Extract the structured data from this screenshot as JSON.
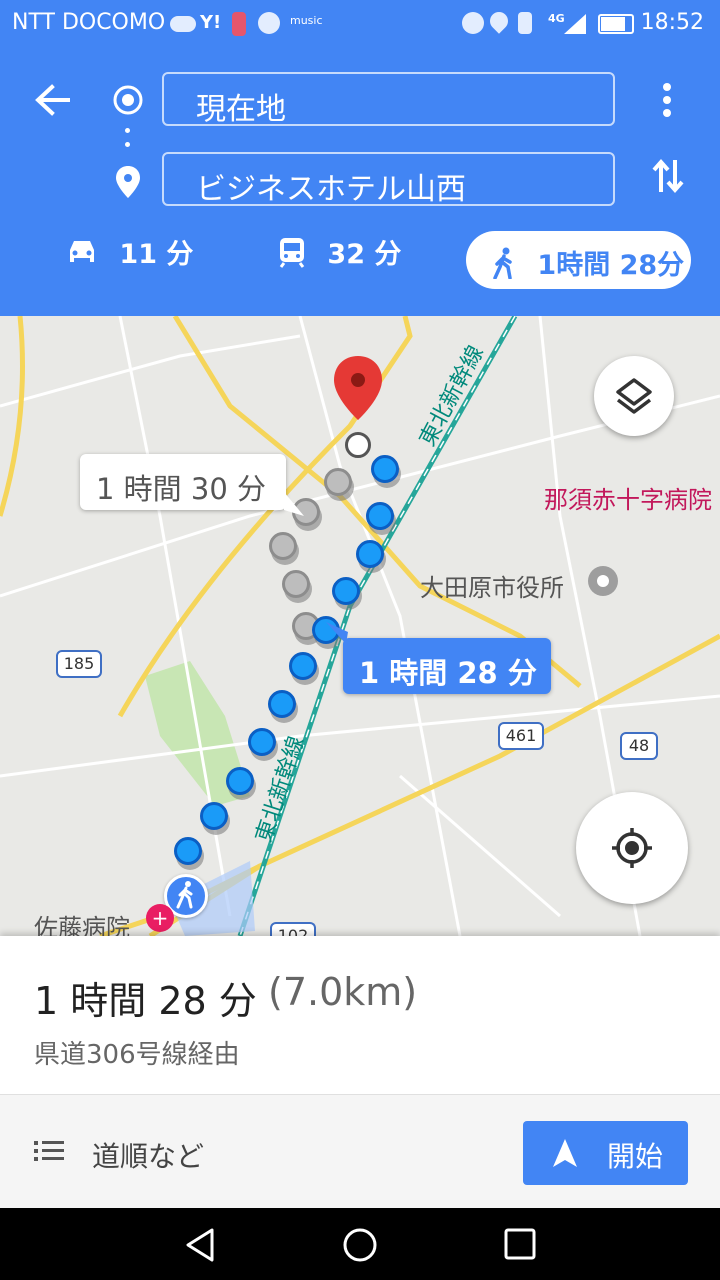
{
  "status_bar": {
    "carrier": "NTT DOCOMO",
    "time": "18:52",
    "network": "4G"
  },
  "directions": {
    "origin": "現在地",
    "destination": "ビジネスホテル山西",
    "modes": [
      {
        "name": "car",
        "label": "11 分",
        "selected": false
      },
      {
        "name": "transit",
        "label": "32 分",
        "selected": false
      },
      {
        "name": "walk",
        "label": "1時間 28分",
        "selected": true
      }
    ]
  },
  "map": {
    "route_bubble_selected": "1 時間 28 分",
    "route_bubble_alt": "1 時間 30 分",
    "labels": {
      "hospital_nasu": "那須赤十字病院",
      "city_hall": "大田原市役所",
      "hospital_sato": "佐藤病院",
      "rail_line": "東北新幹線",
      "route_185": "185",
      "route_461": "461",
      "route_48": "48",
      "route_102": "102"
    }
  },
  "summary": {
    "duration": "1 時間 28 分",
    "distance": "(7.0km)",
    "via": "県道306号線経由"
  },
  "actions": {
    "steps_label": "道順など",
    "start_label": "開始"
  },
  "colors": {
    "accent": "#4285f4",
    "route_dot": "#1a9bf8",
    "alt_dot": "#bdbdbd",
    "marker": "#db4437"
  }
}
